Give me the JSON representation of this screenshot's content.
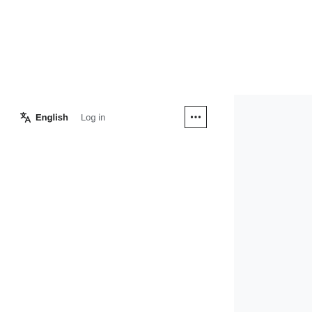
{
  "header": {
    "language_label": "English",
    "login_label": "Log in",
    "icons": {
      "language": "translate-icon",
      "more": "ellipsis-icon"
    }
  },
  "colors": {
    "text": "#202122",
    "muted_text": "#5f6368",
    "panel": "#f8f9fa"
  }
}
